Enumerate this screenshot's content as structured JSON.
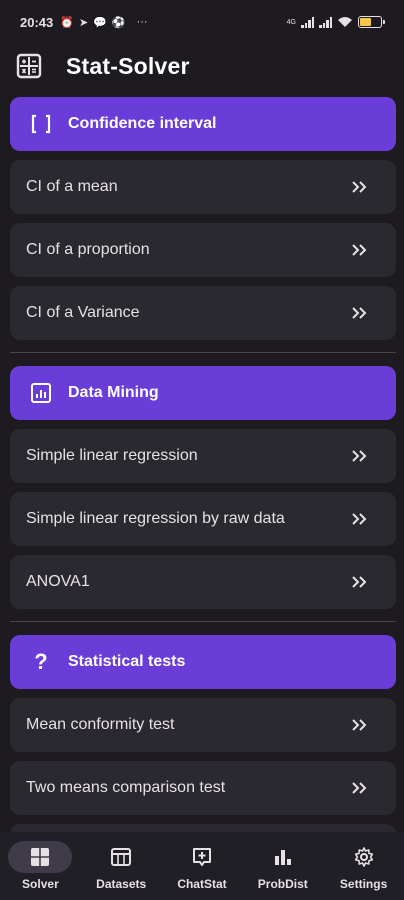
{
  "status_bar": {
    "time": "20:43",
    "icons": [
      "alarm-icon",
      "telegram-icon",
      "chat-icon",
      "soccer-icon",
      "more-icon"
    ],
    "network_label": "4G",
    "battery_color": "#f5c84a"
  },
  "app_bar": {
    "title": "Stat-Solver",
    "icon": "calculator-icon"
  },
  "sections": [
    {
      "title": "Confidence interval",
      "icon": "brackets-icon",
      "items": [
        "CI of a mean",
        "CI of a proportion",
        "CI of a Variance"
      ]
    },
    {
      "title": "Data Mining",
      "icon": "chart-icon",
      "items": [
        "Simple linear regression",
        "Simple linear regression by raw data",
        "ANOVA1"
      ]
    },
    {
      "title": "Statistical tests",
      "icon": "question-icon",
      "items": [
        "Mean conformity test",
        "Two means comparison test"
      ]
    }
  ],
  "bottom_nav": {
    "active": "Solver",
    "items": [
      {
        "label": "Solver",
        "icon": "dashboard-icon"
      },
      {
        "label": "Datasets",
        "icon": "table-icon"
      },
      {
        "label": "ChatStat",
        "icon": "chat-plus-icon"
      },
      {
        "label": "ProbDist",
        "icon": "bar-chart-icon"
      },
      {
        "label": "Settings",
        "icon": "gear-icon"
      }
    ]
  },
  "colors": {
    "background": "#1d1b20",
    "accent": "#6a3dd8",
    "card": "#2b2930",
    "nav_active": "#3f3b49"
  }
}
